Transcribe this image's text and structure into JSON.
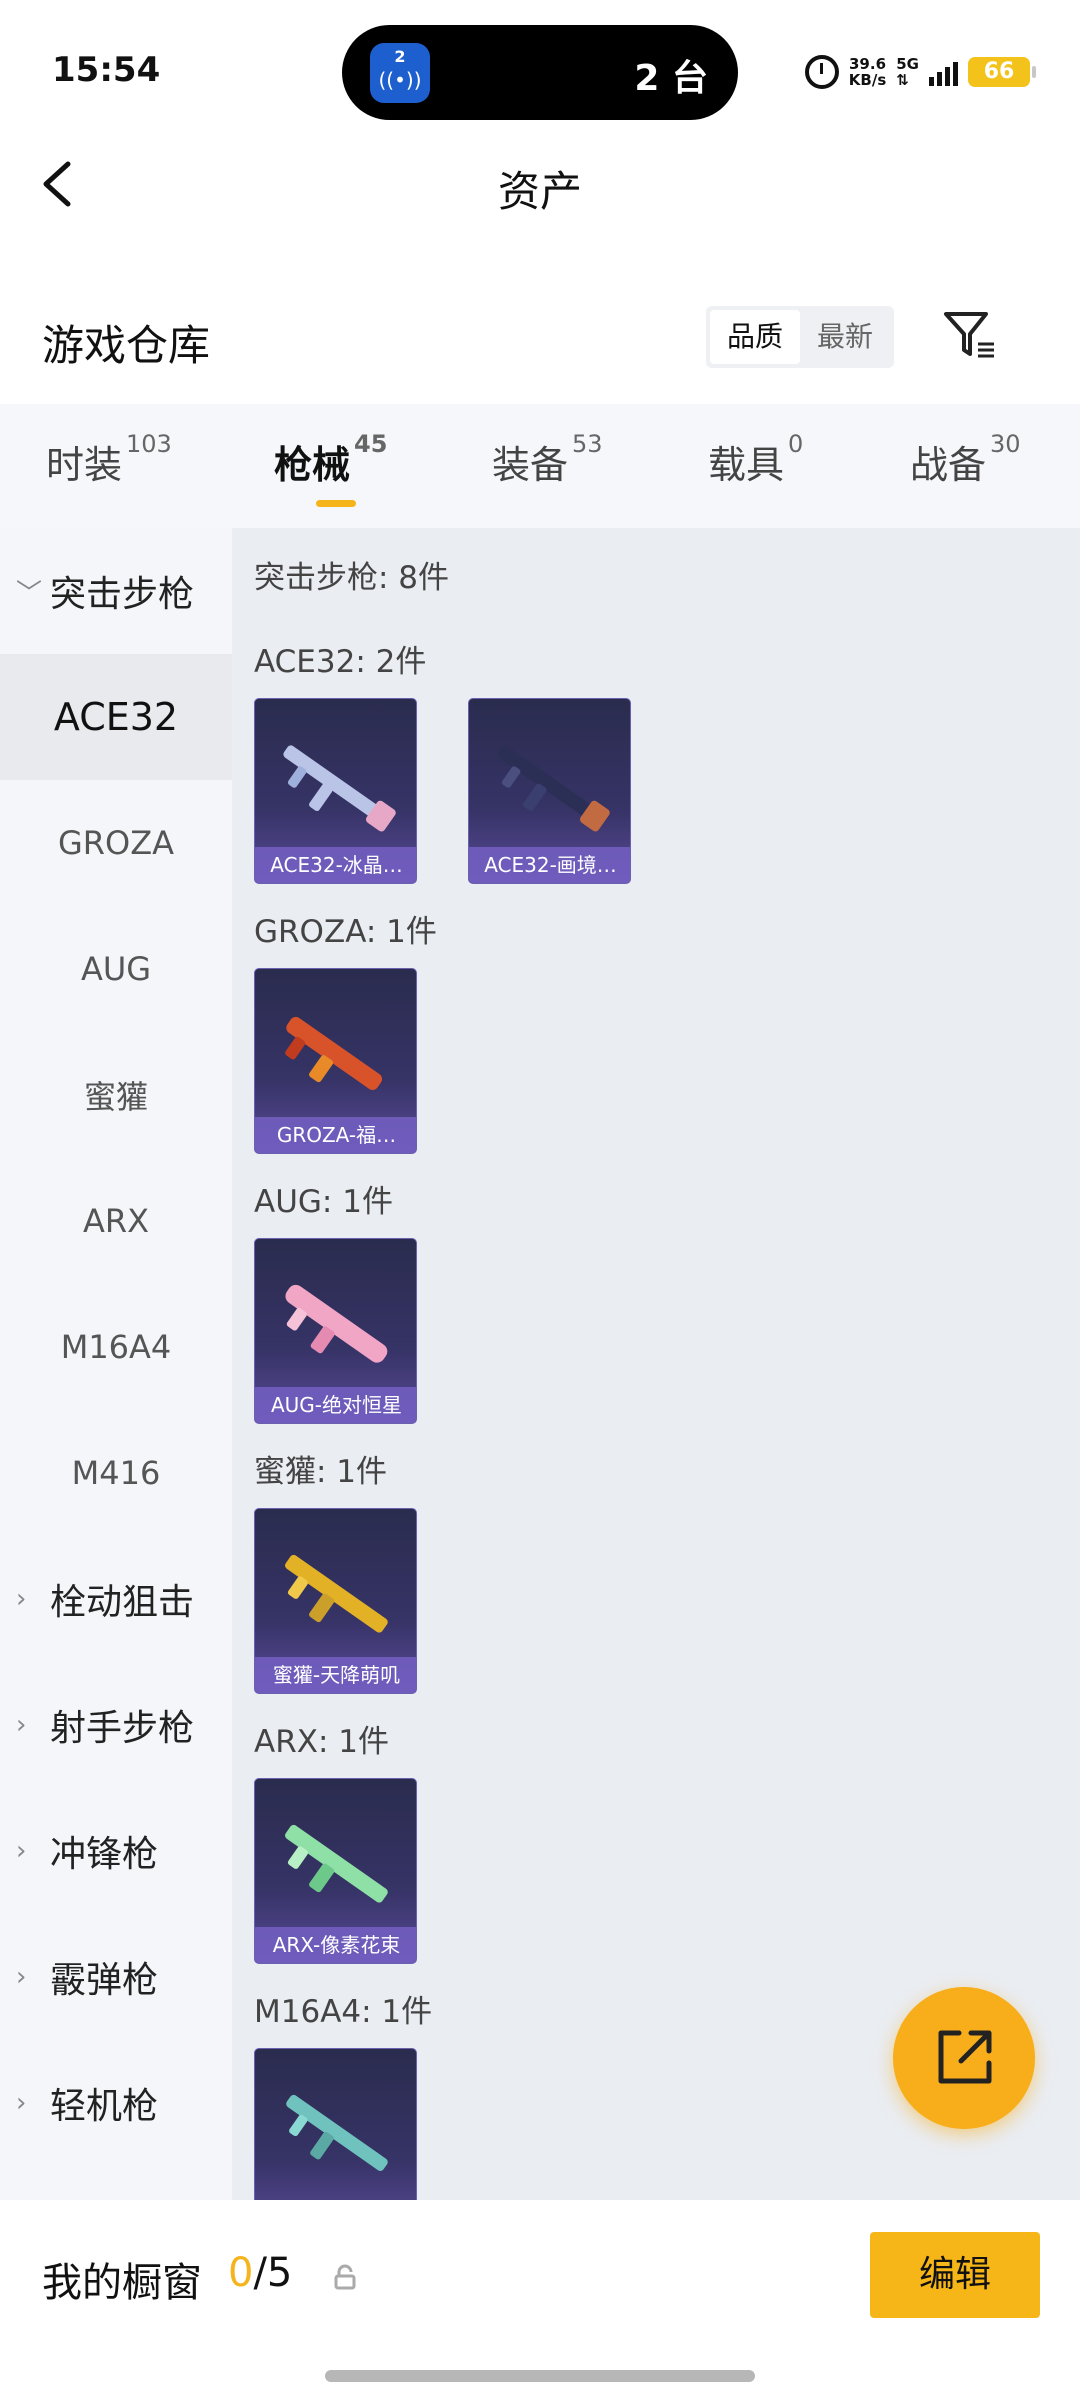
{
  "status_bar": {
    "time": "15:54",
    "island_badge": "2",
    "island_text": "2 台",
    "speed_value": "39.6",
    "speed_unit": "KB/s",
    "network": "5G",
    "battery": "66"
  },
  "header": {
    "title": "资产"
  },
  "warehouse": {
    "title": "游戏仓库",
    "sort_options": [
      "品质",
      "最新"
    ],
    "sort_selected": "品质"
  },
  "tabs": [
    {
      "label": "时装",
      "count": "103"
    },
    {
      "label": "枪械",
      "count": "45"
    },
    {
      "label": "装备",
      "count": "53"
    },
    {
      "label": "载具",
      "count": "0"
    },
    {
      "label": "战备",
      "count": "30"
    }
  ],
  "active_tab": "枪械",
  "sidebar": {
    "expanded_category": "突击步枪",
    "sub_items": [
      "ACE32",
      "GROZA",
      "AUG",
      "蜜獾",
      "ARX",
      "M16A4",
      "M416"
    ],
    "selected": "ACE32",
    "collapsed_categories": [
      "栓动狙击",
      "射手步枪",
      "冲锋枪",
      "霰弹枪",
      "轻机枪"
    ]
  },
  "content": {
    "header": "突击步枪: 8件",
    "groups": [
      {
        "label": "ACE32: 2件",
        "items": [
          "ACE32-冰晶…",
          "ACE32-画境…"
        ]
      },
      {
        "label": "GROZA: 1件",
        "items": [
          "GROZA-福…"
        ]
      },
      {
        "label": "AUG: 1件",
        "items": [
          "AUG-绝对恒星"
        ]
      },
      {
        "label": "蜜獾: 1件",
        "items": [
          "蜜獾-天降萌叽"
        ]
      },
      {
        "label": "ARX: 1件",
        "items": [
          "ARX-像素花束"
        ]
      },
      {
        "label": "M16A4: 1件",
        "items": [
          ""
        ]
      }
    ]
  },
  "item_colors": [
    "#b9c4e6",
    "#2a2e52",
    "#d9532a",
    "#f2a6c6",
    "#e3b126",
    "#8fe0a6",
    "#6fc2bd"
  ],
  "bottom_bar": {
    "showcase_label": "我的橱窗",
    "showcase_current": "0",
    "showcase_total": "/5",
    "edit_label": "编辑"
  },
  "colors": {
    "accent": "#f7b617",
    "tab_indicator": "#f5b41b"
  }
}
